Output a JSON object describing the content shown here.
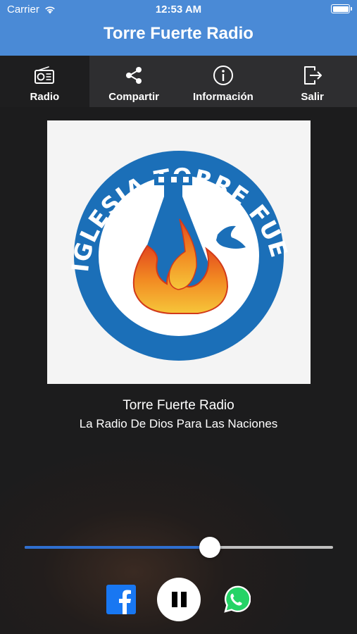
{
  "status_bar": {
    "carrier": "Carrier",
    "time": "12:53 AM"
  },
  "header": {
    "title": "Torre Fuerte Radio"
  },
  "tabs": [
    {
      "label": "Radio",
      "icon": "radio-icon",
      "active": true
    },
    {
      "label": "Compartir",
      "icon": "share-icon",
      "active": false
    },
    {
      "label": "Información",
      "icon": "info-icon",
      "active": false
    },
    {
      "label": "Salir",
      "icon": "exit-icon",
      "active": false
    }
  ],
  "logo": {
    "text": "IGLESIA TORRE FUERTE"
  },
  "station": {
    "name": "Torre Fuerte Radio",
    "slogan": "La Radio De Dios Para Las Naciones"
  },
  "player": {
    "volume": 0.6,
    "state": "playing"
  },
  "colors": {
    "header": "#4a8ad6",
    "tabbar": "#2e2e30",
    "accent": "#2f6fd0",
    "logo_blue": "#1b6fb8"
  }
}
